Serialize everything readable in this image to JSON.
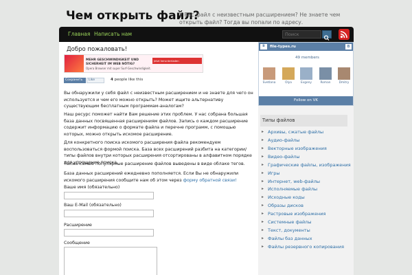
{
  "site": {
    "title": "Чем открыть файл?",
    "description": "У Вас файл с неизвестным расширением? Не знаете чем открыть файл? Тогда вы попали по адресу."
  },
  "nav": {
    "items": [
      "Главная",
      "Написать нам"
    ],
    "search_placeholder": "Поиск"
  },
  "main": {
    "title": "Добро пожаловать!",
    "ad": {
      "line1": "MEHR GESCHWINDIGKEIT UND SICHERHEIT IM WEB NÖTIG?",
      "line2": "Opera Browser mit super Surf-Geschwindigkeit.",
      "button": "Jetzt herunterladen"
    },
    "share_label": "Сохранить",
    "like_label": "Like",
    "like_count": "4",
    "like_text": " people like this",
    "paragraphs": [
      "Вы обнаружили у себя файл с неизвестным расширением и не знаете для чего он используется и чем его можно открыть? Может ищите альтернативу существующим бесплатным программам-аналогам?",
      "Наш ресурс поможет найти Вам решение этих проблем. У нас собрана большая база данных посвященная расширениям файлов.  Запись о каждом расширение содержит информацию о формате файла и перечне программ, с помощью  которых, можно открыть искомое расширение.",
      "Для конкретного поиска искомого расширения файла рекомендуем воспользоваться формой поиска. База всех расширений разбита на категории/типы файлов внутри которых расширения отсортированы в алфавитном порядке для упрощение поиска.",
      "Также самые популярные расширение файлов выведены в виде облаке тегов."
    ],
    "para5_text": "База данных расширений ежедневно пополняется. Если Вы не обнаружили искомого расширения сообщите нам об этом через ",
    "para5_link": "форму обратной связи!",
    "form": {
      "name_label": "Ваше имя (обязательно)",
      "email_label": "Ваш E-Mail (обязательно)",
      "subject_label": "Расширение",
      "message_label": "Сообщение"
    }
  },
  "sidebar": {
    "vk": {
      "name": "file-types.ru",
      "members": "49 members",
      "member_names": [
        "Svetlana",
        "Olya",
        "Evgeny",
        "Roman",
        "Dmitry"
      ],
      "member_colors": [
        "#c89a7a",
        "#d4a85a",
        "#9ab0c8",
        "#7a8fa6",
        "#a88870"
      ],
      "follow_label": "Follow on VK",
      "brand_color": "#5b7fa6"
    },
    "categories_title": "Типы файлов",
    "categories": [
      "Архивы, сжатые файлы",
      "Аудио-файлы",
      "Векторные изображения",
      "Видео-файлы",
      "Графические файлы, изображения",
      "Игры",
      "Интернет, web-файлы",
      "Исполняемые файлы",
      "Исходные коды",
      "Образы дисков",
      "Растровые изображения",
      "Системные файлы",
      "Текст, документы",
      "Файлы баз данных",
      "Файлы резервного копирования"
    ]
  }
}
